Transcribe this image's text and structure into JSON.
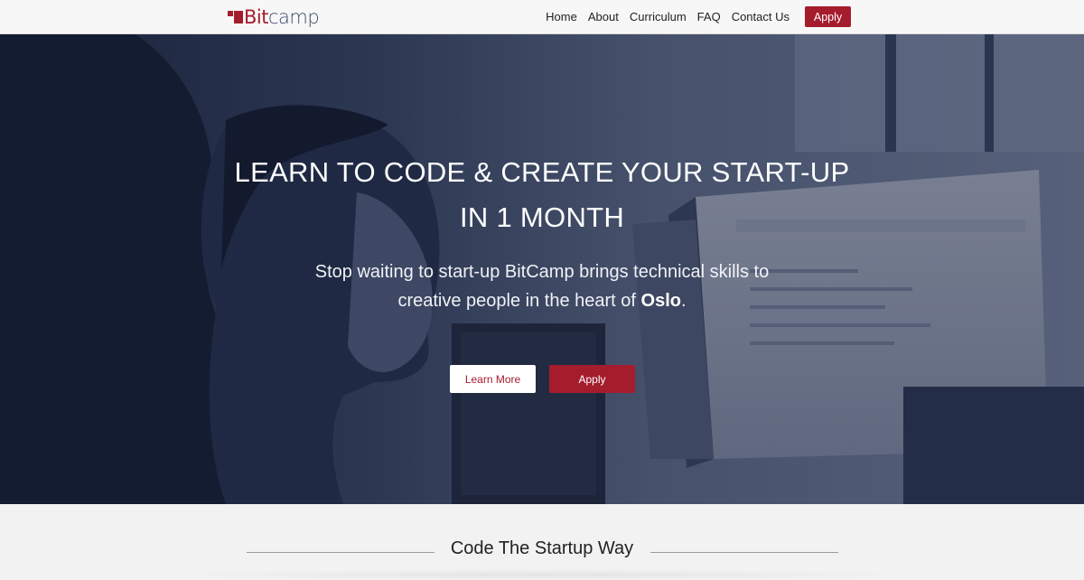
{
  "brand": {
    "bit": "Bit",
    "camp": "camp",
    "accent_color": "#a51d2d",
    "secondary_color": "#3f4b6e"
  },
  "nav": {
    "links": [
      "Home",
      "About",
      "Curriculum",
      "FAQ",
      "Contact Us"
    ],
    "apply_label": "Apply"
  },
  "hero": {
    "title_line1": "LEARN TO CODE & CREATE YOUR START-UP",
    "title_line2": "IN 1 MONTH",
    "subtitle_line1": "Stop waiting to start-up BitCamp brings technical skills to",
    "subtitle_line2_pre": "creative people in the heart of ",
    "subtitle_line2_bold": "Oslo",
    "subtitle_line2_post": ".",
    "learn_more_label": "Learn More",
    "apply_label": "Apply"
  },
  "section": {
    "heading": "Code The Startup Way"
  }
}
